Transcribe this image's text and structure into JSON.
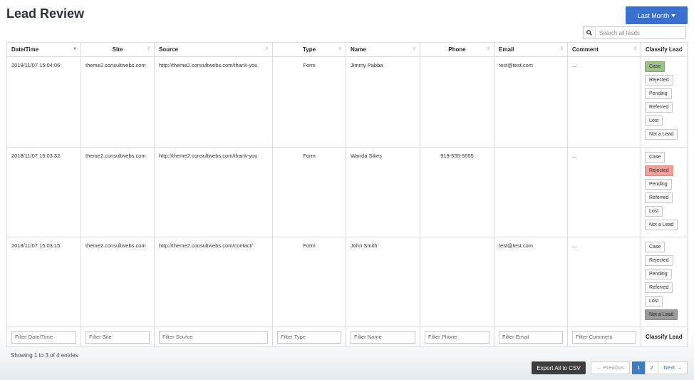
{
  "page": {
    "title": "Lead Review"
  },
  "period": {
    "label": "Last Month"
  },
  "search": {
    "placeholder": "Search all leads"
  },
  "table": {
    "columns": [
      {
        "key": "datetime",
        "label": "Date/Time"
      },
      {
        "key": "site",
        "label": "Site"
      },
      {
        "key": "source",
        "label": "Source"
      },
      {
        "key": "type",
        "label": "Type"
      },
      {
        "key": "name",
        "label": "Name"
      },
      {
        "key": "phone",
        "label": "Phone"
      },
      {
        "key": "email",
        "label": "Email"
      },
      {
        "key": "comment",
        "label": "Comment"
      },
      {
        "key": "classify",
        "label": "Classify Lead"
      }
    ],
    "rows": [
      {
        "datetime": "2018/11/07 15:04:06",
        "site": "theme2.consultwebs.com",
        "source": "http://theme2.consultwebs.com/thank-you",
        "type": "Form",
        "name": "Jimmy Pabba",
        "phone": "",
        "email": "test@test.com",
        "comment": "...",
        "selected": "Case"
      },
      {
        "datetime": "2018/11/07 15:03:32",
        "site": "theme2.consultwebs.com",
        "source": "http://theme2.consultwebs.com/thank-you",
        "type": "Form",
        "name": "Wanda Sikes",
        "phone": "919-555-5555",
        "email": "",
        "comment": "...",
        "selected": "Rejected"
      },
      {
        "datetime": "2018/11/07 15:03:15",
        "site": "theme2.consultwebs.com",
        "source": "http://theme2.consultwebs.com/contact/",
        "type": "Form",
        "name": "John Smith",
        "phone": "",
        "email": "test@test.com",
        "comment": "...",
        "selected": "Not a Lead"
      }
    ],
    "classify_options": [
      "Case",
      "Rejected",
      "Pending",
      "Referred",
      "Lost",
      "Not a Lead"
    ],
    "filters": [
      "Filter Date/Time",
      "Filter Site",
      "Filter Source",
      "Filter Type",
      "Filter Name",
      "Filter Phone",
      "Filter Email",
      "Filter Comment"
    ],
    "footer_classify_label": "Classify Lead"
  },
  "footer": {
    "entries_info": "Showing 1 to 3 of 4 entries",
    "export_label": "Export All to CSV",
    "pagination": {
      "previous": "← Previous",
      "pages": [
        "1",
        "2"
      ],
      "current": "1",
      "next": "Next →"
    }
  },
  "colors": {
    "primary": "#3a6fd0",
    "case_selected": "#9fc08c",
    "rejected_selected": "#f1a09a",
    "not_a_lead_selected": "#9b9b9b",
    "export": "#3d3d3d",
    "page_current": "#3f7bbf"
  }
}
